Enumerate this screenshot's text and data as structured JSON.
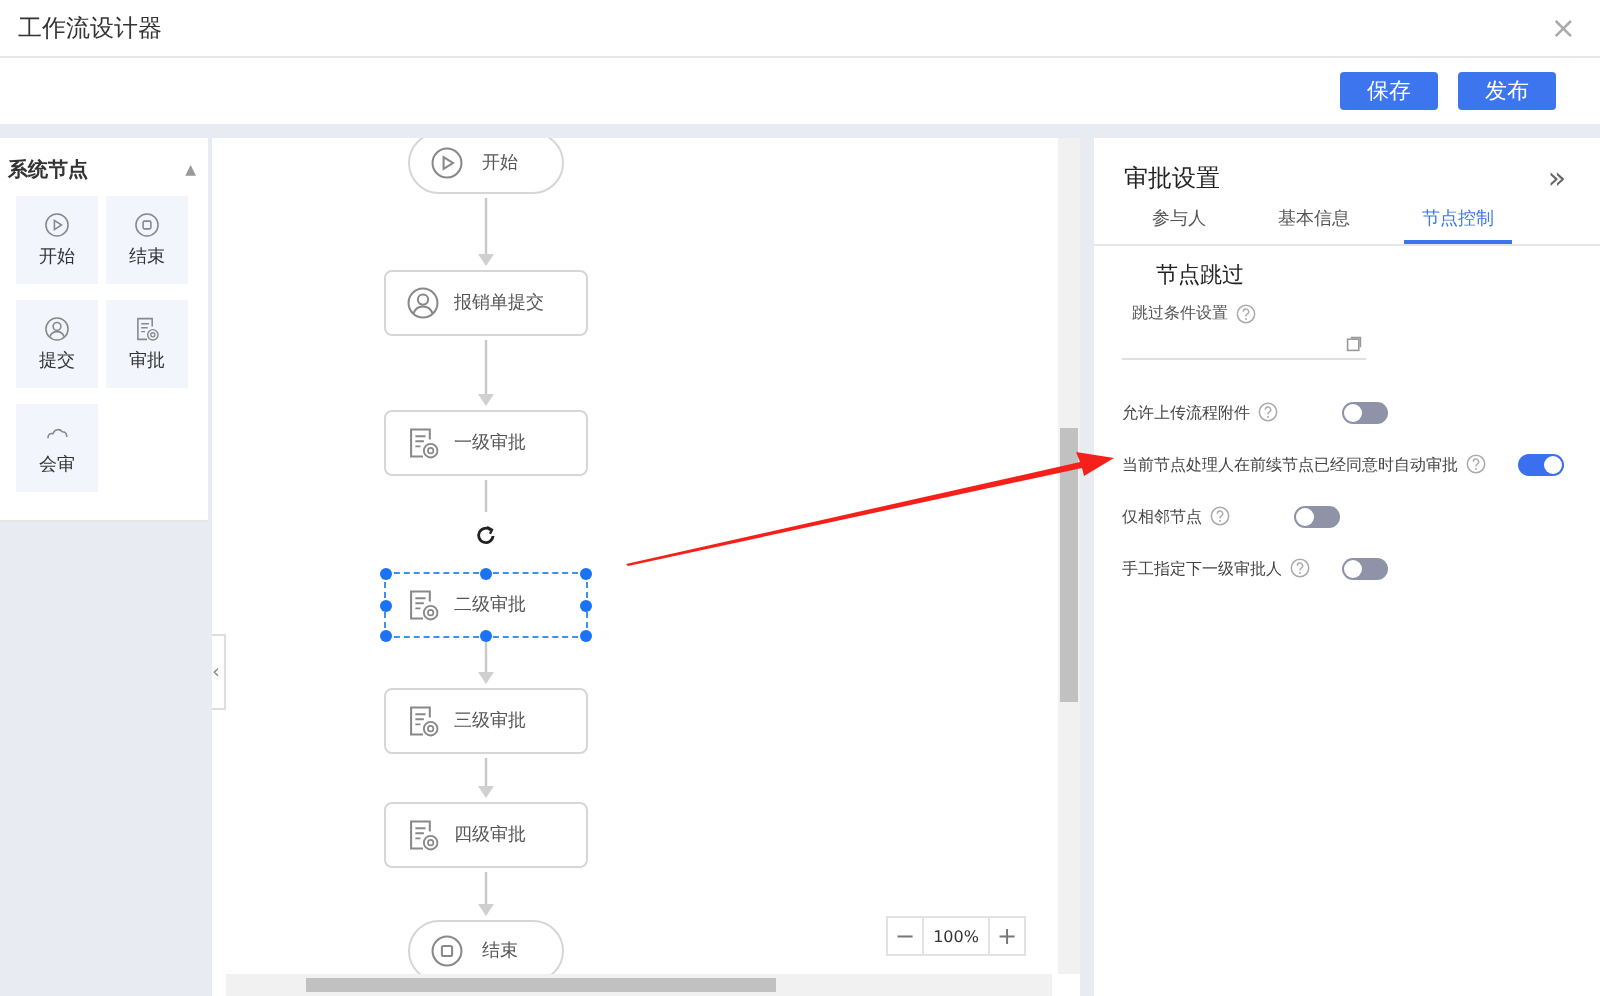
{
  "window": {
    "title": "工作流设计器",
    "close": "×"
  },
  "toolbar": {
    "buttons": [
      "保存",
      "发布"
    ]
  },
  "palette": {
    "title": "系统节点",
    "collapse": "▲",
    "items": [
      {
        "label": "开始",
        "kind": "start"
      },
      {
        "label": "结束",
        "kind": "end"
      },
      {
        "label": "提交",
        "kind": "submit"
      },
      {
        "label": "审批",
        "kind": "approve"
      },
      {
        "label": "会审",
        "kind": "countersign"
      }
    ]
  },
  "canvas": {
    "nodes": [
      {
        "label": "开始",
        "kind": "start",
        "selected": false
      },
      {
        "label": "报销单提交",
        "kind": "submit",
        "selected": false
      },
      {
        "label": "一级审批",
        "kind": "approve",
        "selected": false
      },
      {
        "label": "二级审批",
        "kind": "approve",
        "selected": true
      },
      {
        "label": "三级审批",
        "kind": "approve",
        "selected": false
      },
      {
        "label": "四级审批",
        "kind": "approve",
        "selected": false
      },
      {
        "label": "结束",
        "kind": "end",
        "selected": false
      }
    ],
    "zoom": {
      "minus": "−",
      "value": "100%",
      "plus": "+"
    },
    "side_toggle": "‹"
  },
  "panel": {
    "title": "审批设置",
    "expand": "»",
    "tabs": [
      {
        "label": "参与人",
        "selected": false
      },
      {
        "label": "基本信息",
        "selected": false
      },
      {
        "label": "节点控制",
        "selected": true
      }
    ],
    "section": "节点跳过",
    "field_label": "跳过条件设置",
    "toggles": [
      {
        "label": "允许上传流程附件",
        "on": false
      },
      {
        "label": "当前节点处理人在前续节点已经同意时自动审批",
        "on": true
      },
      {
        "label": "仅相邻节点",
        "on": false
      },
      {
        "label": "手工指定下一级审批人",
        "on": false
      }
    ]
  }
}
